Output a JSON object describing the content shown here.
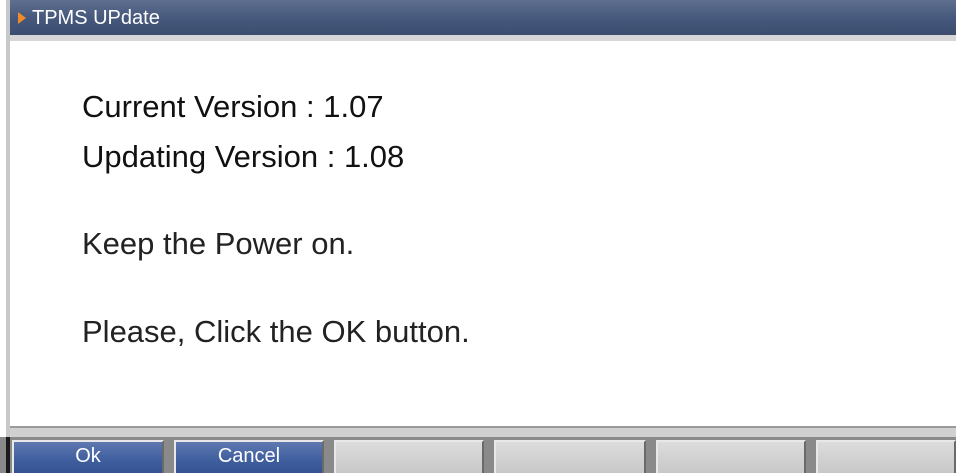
{
  "window": {
    "title": "TPMS UPdate"
  },
  "content": {
    "current_version": "Current Version : 1.07",
    "updating_version": "Updating Version : 1.08",
    "message_power": "Keep the Power on.",
    "message_click": "Please, Click the OK button."
  },
  "buttons": {
    "ok_label": "Ok",
    "cancel_label": "Cancel"
  },
  "colors": {
    "titlebar": "#45577a",
    "title_arrow": "#f08a2a",
    "button_active": "#3f5e9e",
    "button_inactive": "#c8c8c8"
  },
  "icons": {
    "title": "triangle-arrow-icon"
  }
}
